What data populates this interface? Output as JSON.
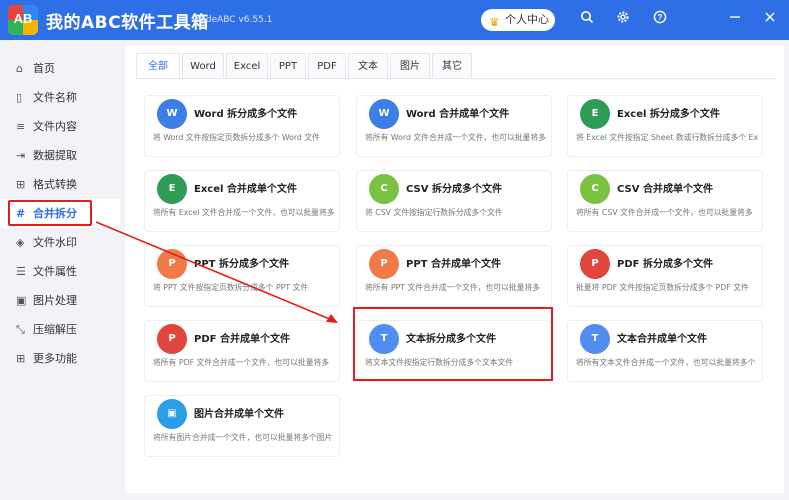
{
  "app": {
    "logo_text": "AB",
    "title": "我的ABC软件工具箱",
    "version": "WodeABC v6.55.1",
    "vip_label": "个人中心"
  },
  "window_icons": [
    "search-icon",
    "gear-icon",
    "help-icon",
    "minimize-icon",
    "close-icon"
  ],
  "sidebar": {
    "items": [
      {
        "label": "首页",
        "icon": "home-icon",
        "glyph": "⌂"
      },
      {
        "label": "文件名称",
        "icon": "file-icon",
        "glyph": "▯"
      },
      {
        "label": "文件内容",
        "icon": "list-icon",
        "glyph": "≡"
      },
      {
        "label": "数据提取",
        "icon": "extract-icon",
        "glyph": "⇥"
      },
      {
        "label": "格式转换",
        "icon": "convert-icon",
        "glyph": "⊞"
      },
      {
        "label": "合并拆分",
        "icon": "hash-icon",
        "glyph": "#"
      },
      {
        "label": "文件水印",
        "icon": "shield-icon",
        "glyph": "◈"
      },
      {
        "label": "文件属性",
        "icon": "properties-icon",
        "glyph": "☰"
      },
      {
        "label": "图片处理",
        "icon": "image-icon",
        "glyph": "▣"
      },
      {
        "label": "压缩解压",
        "icon": "compress-icon",
        "glyph": "⤡"
      },
      {
        "label": "更多功能",
        "icon": "grid-icon",
        "glyph": "⊞"
      }
    ],
    "active_index": 5
  },
  "tabs": {
    "items": [
      "全部",
      "Word",
      "Excel",
      "PPT",
      "PDF",
      "文本",
      "图片",
      "其它"
    ],
    "active_index": 0
  },
  "cards": [
    {
      "title": "Word 拆分成多个文件",
      "desc": "将 Word 文件按指定页数拆分成多个 Word 文件",
      "icon_letter": "W",
      "color": "#3b7ee8",
      "icon": "word-icon"
    },
    {
      "title": "Word 合并成单个文件",
      "desc": "将所有 Word 文件合并成一个文件，也可以批量将多",
      "icon_letter": "W",
      "color": "#3b7ee8",
      "icon": "word-icon"
    },
    {
      "title": "Excel 拆分成多个文件",
      "desc": "将 Excel 文件按指定 Sheet 数或行数拆分成多个 Ex",
      "icon_letter": "E",
      "color": "#2e9b57",
      "icon": "excel-icon"
    },
    {
      "title": "Excel 合并成单个文件",
      "desc": "将所有 Excel 文件合并成一个文件，也可以批量将多",
      "icon_letter": "E",
      "color": "#2e9b57",
      "icon": "excel-icon"
    },
    {
      "title": "CSV 拆分成多个文件",
      "desc": "将 CSV 文件按指定行数拆分成多个文件",
      "icon_letter": "C",
      "color": "#7cc242",
      "icon": "csv-icon"
    },
    {
      "title": "CSV 合并成单个文件",
      "desc": "将所有 CSV 文件合并成一个文件，也可以批量将多",
      "icon_letter": "C",
      "color": "#7cc242",
      "icon": "csv-icon"
    },
    {
      "title": "PPT 拆分成多个文件",
      "desc": "将 PPT 文件按指定页数拆分成多个 PPT 文件",
      "icon_letter": "P",
      "color": "#f07a4a",
      "icon": "ppt-icon"
    },
    {
      "title": "PPT 合并成单个文件",
      "desc": "将所有 PPT 文件合并成一个文件，也可以批量将多",
      "icon_letter": "P",
      "color": "#f07a4a",
      "icon": "ppt-icon"
    },
    {
      "title": "PDF 拆分成多个文件",
      "desc": "批量将 PDF 文件按指定页数拆分成多个 PDF 文件",
      "icon_letter": "P",
      "color": "#e0463c",
      "icon": "pdf-icon"
    },
    {
      "title": "PDF 合并成单个文件",
      "desc": "将所有 PDF 文件合并成一个文件，也可以批量将多",
      "icon_letter": "P",
      "color": "#e0463c",
      "icon": "pdf-icon"
    },
    {
      "title": "文本拆分成多个文件",
      "desc": "将文本文件按指定行数拆分成多个文本文件",
      "icon_letter": "T",
      "color": "#4f8ef0",
      "icon": "text-icon"
    },
    {
      "title": "文本合并成单个文件",
      "desc": "将所有文本文件合并成一个文件，也可以批量将多个",
      "icon_letter": "T",
      "color": "#4f8ef0",
      "icon": "text-icon"
    },
    {
      "title": "图片合并成单个文件",
      "desc": "将所有图片合并成一个文件，也可以批量将多个图片",
      "icon_letter": "▣",
      "color": "#2a9fe8",
      "icon": "image-icon"
    }
  ],
  "highlight_color": "#e02020",
  "accent_color": "#2f6fe6"
}
